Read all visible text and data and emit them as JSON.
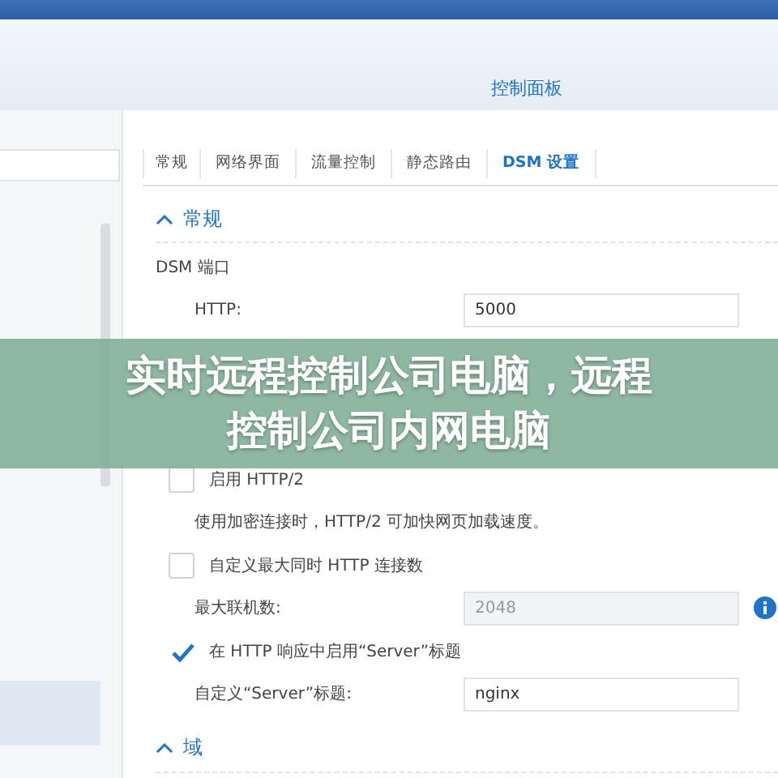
{
  "window": {
    "title": "控制面板"
  },
  "sidebar": {
    "items": [
      {
        "selected": true
      }
    ]
  },
  "tabs": [
    {
      "label": "常规",
      "selected": false
    },
    {
      "label": "网络界面",
      "selected": false
    },
    {
      "label": "流量控制",
      "selected": false
    },
    {
      "label": "静态路由",
      "selected": false
    },
    {
      "label": "DSM 设置",
      "selected": true
    }
  ],
  "sections": [
    {
      "title": "常规",
      "expanded": true,
      "subtitle": "DSM 端口",
      "rows": [
        {
          "kind": "field",
          "label": "HTTP:",
          "value": "5000",
          "disabled": false,
          "info": false
        },
        {
          "kind": "gap"
        },
        {
          "kind": "checkbox",
          "label": "启用 HTTP/2",
          "checked": false
        },
        {
          "kind": "note",
          "text": "使用加密连接时，HTTP/2 可加快网页加载速度。"
        },
        {
          "kind": "checkbox",
          "label": "自定义最大同时 HTTP 连接数",
          "checked": false
        },
        {
          "kind": "field",
          "label": "最大联机数:",
          "value": "2048",
          "disabled": true,
          "info": true
        },
        {
          "kind": "checkbox",
          "label": "在 HTTP 响应中启用“Server”标题",
          "checked": true
        },
        {
          "kind": "field",
          "label": "自定义“Server”标题:",
          "value": "nginx",
          "disabled": false,
          "info": false
        }
      ]
    },
    {
      "title": "域",
      "expanded": true
    }
  ],
  "banner": {
    "lines": [
      "实时远程控制公司电脑，远程",
      "控制公司内网电脑"
    ]
  }
}
